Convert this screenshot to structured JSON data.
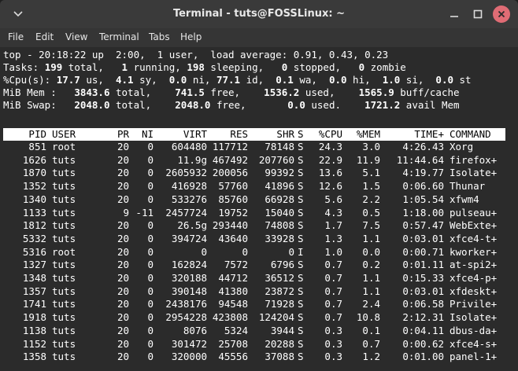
{
  "window": {
    "title": "Terminal - tuts@FOSSLinux: ~"
  },
  "menu": [
    "File",
    "Edit",
    "View",
    "Terminal",
    "Tabs",
    "Help"
  ],
  "summary": {
    "line1": "top - 20:18:22 up  2:00,  1 user,  load average: 0.91, 0.43, 0.23",
    "tasks": {
      "total": "199",
      "running": "1",
      "sleeping": "198",
      "stopped": "0",
      "zombie": "0"
    },
    "cpu": {
      "us": "17.7",
      "sy": "4.1",
      "ni": "0.0",
      "id": "77.1",
      "wa": "0.1",
      "hi": "0.0",
      "si": "1.0",
      "st": "0.0"
    },
    "mem": {
      "total": "3843.6",
      "free": "741.5",
      "used": "1536.2",
      "buff": "1565.9"
    },
    "swap": {
      "total": "2048.0",
      "free": "2048.0",
      "used": "0.0",
      "avail": "1721.2"
    }
  },
  "columns": [
    "PID",
    "USER",
    "PR",
    "NI",
    "VIRT",
    "RES",
    "SHR",
    "S",
    "%CPU",
    "%MEM",
    "TIME+",
    "COMMAND"
  ],
  "processes": [
    [
      "851",
      "root",
      "20",
      "0",
      "604480",
      "117712",
      "78148",
      "S",
      "24.3",
      "3.0",
      "4:26.43",
      "Xorg"
    ],
    [
      "1626",
      "tuts",
      "20",
      "0",
      "11.9g",
      "467492",
      "207760",
      "S",
      "22.9",
      "11.9",
      "11:44.64",
      "firefox+"
    ],
    [
      "1870",
      "tuts",
      "20",
      "0",
      "2605932",
      "200056",
      "99392",
      "S",
      "13.6",
      "5.1",
      "4:19.77",
      "Isolate+"
    ],
    [
      "1352",
      "tuts",
      "20",
      "0",
      "416928",
      "57760",
      "41896",
      "S",
      "12.6",
      "1.5",
      "0:06.60",
      "Thunar"
    ],
    [
      "1340",
      "tuts",
      "20",
      "0",
      "533276",
      "85760",
      "66928",
      "S",
      "5.6",
      "2.2",
      "1:05.54",
      "xfwm4"
    ],
    [
      "1133",
      "tuts",
      "9",
      "-11",
      "2457724",
      "19752",
      "15040",
      "S",
      "4.3",
      "0.5",
      "1:18.00",
      "pulseau+"
    ],
    [
      "1812",
      "tuts",
      "20",
      "0",
      "26.5g",
      "293440",
      "74808",
      "S",
      "1.7",
      "7.5",
      "0:57.47",
      "WebExte+"
    ],
    [
      "5332",
      "tuts",
      "20",
      "0",
      "394724",
      "43640",
      "33928",
      "S",
      "1.3",
      "1.1",
      "0:03.01",
      "xfce4-t+"
    ],
    [
      "5316",
      "root",
      "20",
      "0",
      "0",
      "0",
      "0",
      "I",
      "1.0",
      "0.0",
      "0:00.71",
      "kworker+"
    ],
    [
      "1327",
      "tuts",
      "20",
      "0",
      "162824",
      "7572",
      "6796",
      "S",
      "0.7",
      "0.2",
      "0:01.11",
      "at-spi2+"
    ],
    [
      "1348",
      "tuts",
      "20",
      "0",
      "320188",
      "44712",
      "36512",
      "S",
      "0.7",
      "1.1",
      "0:15.33",
      "xfce4-p+"
    ],
    [
      "1357",
      "tuts",
      "20",
      "0",
      "390148",
      "41380",
      "23872",
      "S",
      "0.7",
      "1.1",
      "0:03.01",
      "xfdeskt+"
    ],
    [
      "1741",
      "tuts",
      "20",
      "0",
      "2438176",
      "94548",
      "71928",
      "S",
      "0.7",
      "2.4",
      "0:06.58",
      "Privile+"
    ],
    [
      "1918",
      "tuts",
      "20",
      "0",
      "2954228",
      "423808",
      "124204",
      "S",
      "0.7",
      "10.8",
      "2:12.31",
      "Isolate+"
    ],
    [
      "1138",
      "tuts",
      "20",
      "0",
      "8076",
      "5324",
      "3944",
      "S",
      "0.3",
      "0.1",
      "0:04.11",
      "dbus-da+"
    ],
    [
      "1152",
      "tuts",
      "20",
      "0",
      "301472",
      "25708",
      "20288",
      "S",
      "0.3",
      "0.7",
      "0:00.62",
      "xfce4-s+"
    ],
    [
      "1358",
      "tuts",
      "20",
      "0",
      "320000",
      "45556",
      "37088",
      "S",
      "0.3",
      "1.2",
      "0:01.00",
      "panel-1+"
    ]
  ]
}
